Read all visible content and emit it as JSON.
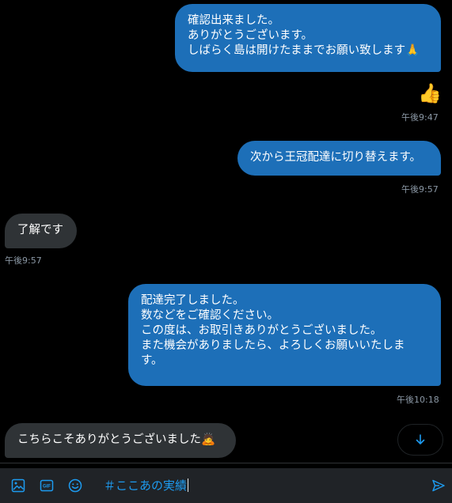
{
  "messages": [
    {
      "direction": "out",
      "lines": [
        "確認出来ました。",
        "ありがとうございます。",
        "しばらく島は開けたままでお願い致します🙏"
      ]
    },
    {
      "direction": "out",
      "emoji": "👍",
      "time": "午後9:47"
    },
    {
      "direction": "out",
      "lines": [
        "次から王冠配達に切り替えます。"
      ],
      "time": "午後9:57"
    },
    {
      "direction": "in",
      "lines": [
        "了解です"
      ],
      "time": "午後9:57"
    },
    {
      "direction": "out",
      "lines": [
        "配達完了しました。",
        "数などをご確認ください。",
        "この度は、お取引きありがとうございました。",
        "また機会がありましたら、よろしくお願いいたしま",
        "す。"
      ],
      "time": "午後10:18"
    },
    {
      "direction": "in",
      "lines": [
        "こちらこそありがとうございました🙇"
      ]
    }
  ],
  "scroll_down": {
    "icon": "arrow-down-icon"
  },
  "composer": {
    "input_value": "＃ここあの実績",
    "icons": [
      "image-icon",
      "gif-icon",
      "emoji-icon"
    ],
    "send_icon": "send-icon"
  },
  "colors": {
    "outgoing_bubble": "#1d6fb8",
    "incoming_bubble": "#2f3336",
    "accent": "#1d9bf0",
    "background": "#000000"
  }
}
